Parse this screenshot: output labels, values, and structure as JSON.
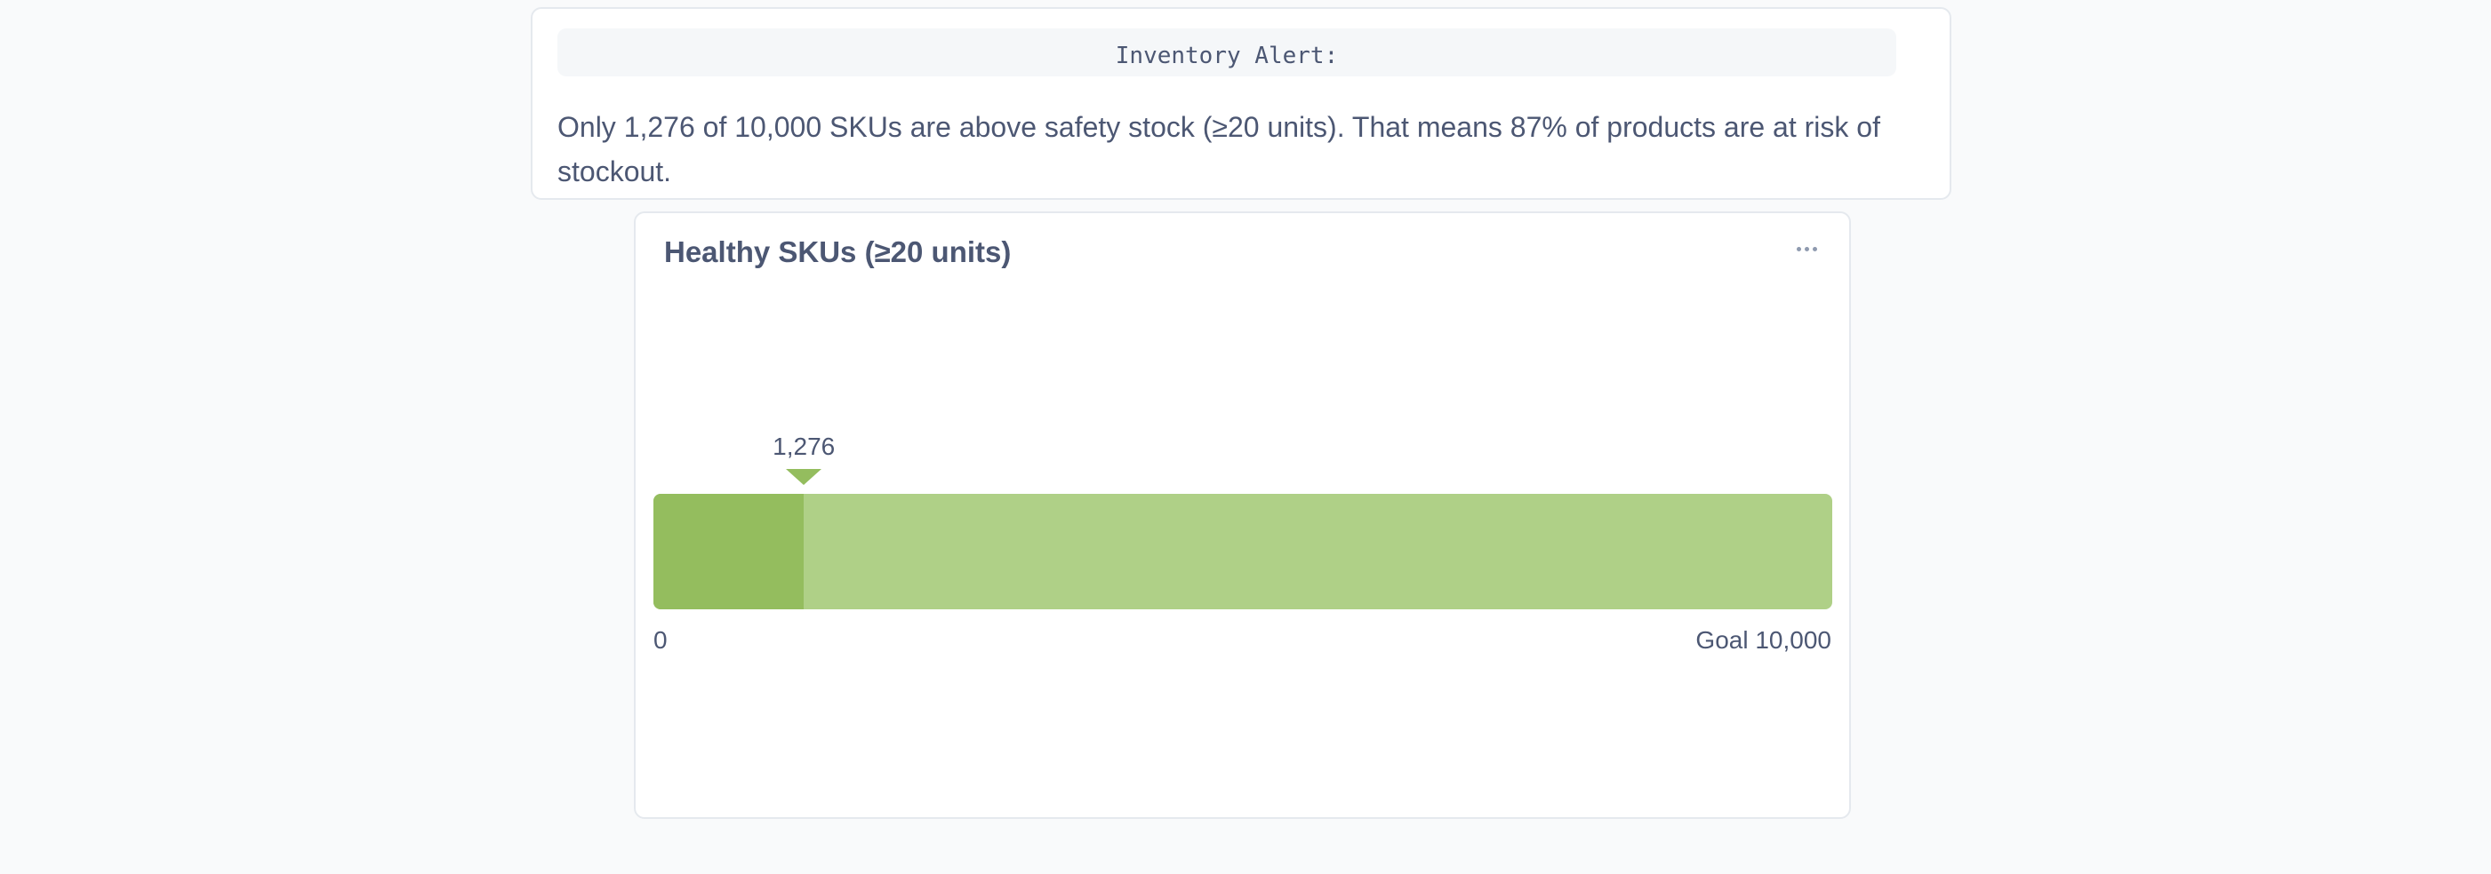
{
  "alert_card": {
    "code_text": "Inventory Alert:",
    "body_text": "Only 1,276 of 10,000 SKUs are above safety stock (≥20 units). That means 87% of products are at risk of stockout."
  },
  "progress_card": {
    "title": "Healthy SKUs (≥20 units)",
    "menu_icon": "ellipsis-icon",
    "current_label": "1,276",
    "min_label": "0",
    "goal_label": "Goal 10,000",
    "colors": {
      "fill": "#94bd5e",
      "track": "#afd087"
    }
  },
  "chart_data": {
    "type": "bar",
    "title": "Healthy SKUs (≥20 units)",
    "value": 1276,
    "min": 0,
    "goal": 10000
  }
}
